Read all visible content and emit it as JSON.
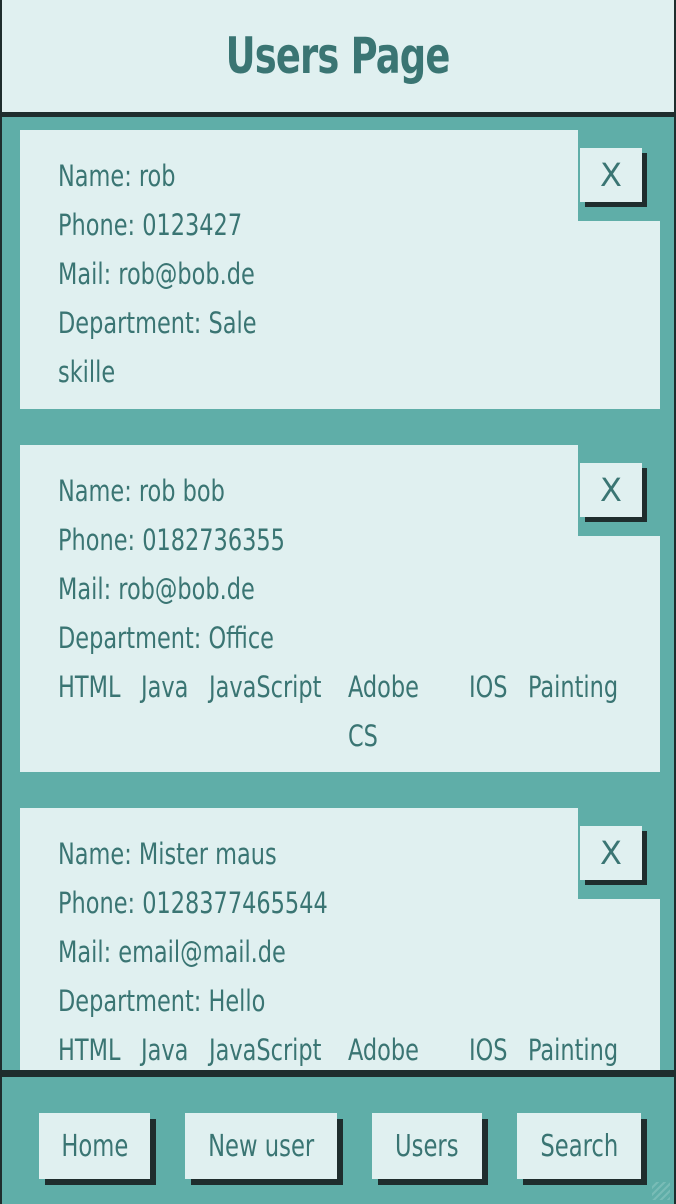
{
  "header": {
    "title": "Users Page"
  },
  "users": [
    {
      "name": "Name: rob",
      "phone": "Phone: 0123427",
      "mail": "Mail: rob@bob.de",
      "department": "Department: Sale",
      "extra": "skille",
      "delete_label": "X"
    },
    {
      "name": "Name: rob bob",
      "phone": "Phone: 0182736355",
      "mail": "Mail: rob@bob.de",
      "department": "Department: Office",
      "skills": [
        "HTML",
        "Java",
        "JavaScript",
        "Adobe CS",
        "IOS",
        "Painting"
      ],
      "delete_label": "X"
    },
    {
      "name": "Name: Mister maus",
      "phone": "Phone: 0128377465544",
      "mail": "Mail: email@mail.de",
      "department": "Department: Hello",
      "skills": [
        "HTML",
        "Java",
        "JavaScript",
        "Adobe",
        "IOS",
        "Painting"
      ],
      "delete_label": "X"
    }
  ],
  "nav": {
    "home": "Home",
    "new_user": "New user",
    "users": "Users",
    "search": "Search"
  },
  "colors": {
    "background": "#5faea8",
    "card": "#e0f0f0",
    "text": "#3a7573",
    "shadow": "#1f2d2d"
  }
}
